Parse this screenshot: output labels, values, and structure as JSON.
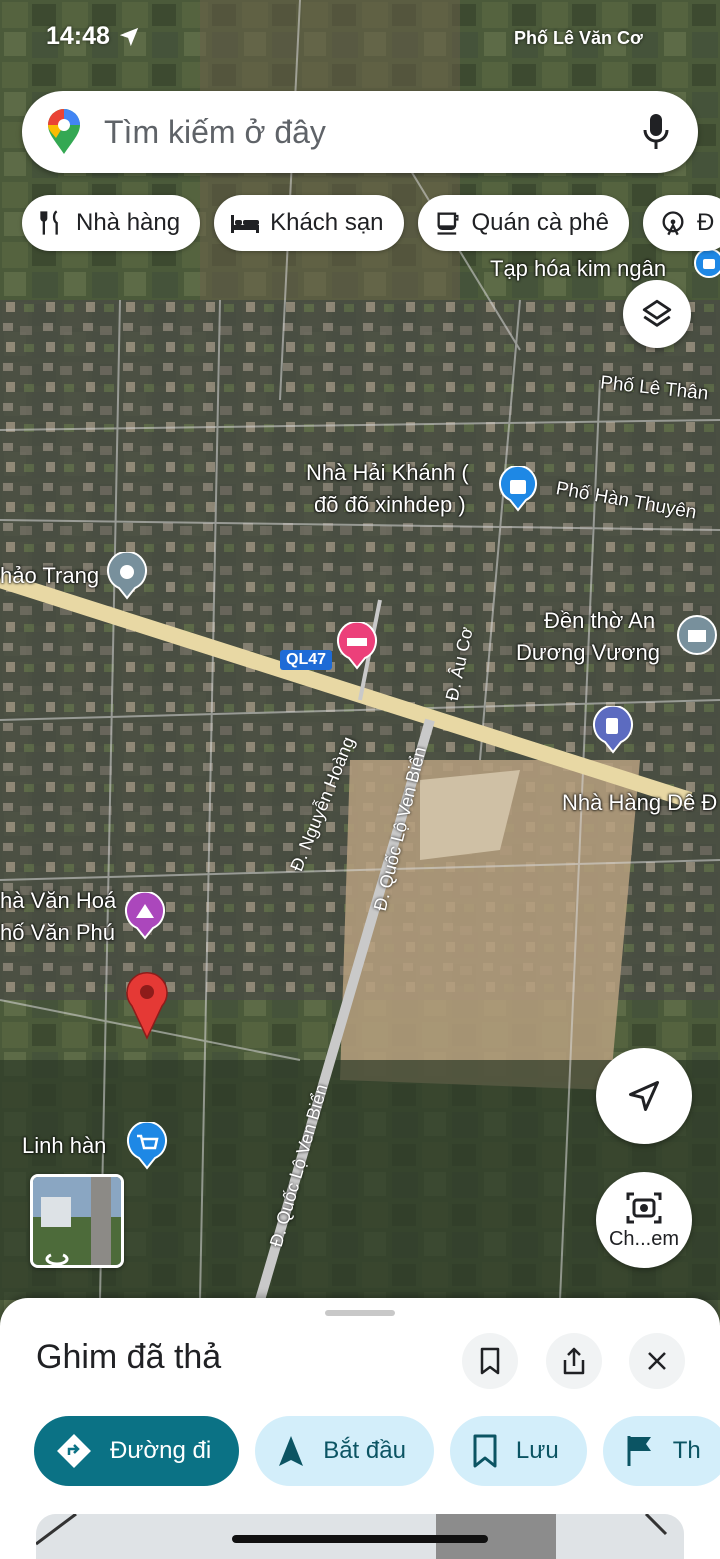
{
  "status": {
    "time": "14:48",
    "right_text": "Phố Lê Văn Cơ"
  },
  "search": {
    "placeholder": "Tìm kiếm ở đây"
  },
  "chips": [
    {
      "label": "Nhà hàng",
      "icon": "restaurant-icon"
    },
    {
      "label": "Khách sạn",
      "icon": "hotel-icon"
    },
    {
      "label": "Quán cà phê",
      "icon": "coffee-icon"
    },
    {
      "label": "Đ",
      "icon": "attractions-icon"
    }
  ],
  "map_labels": {
    "tap_hoa": "Tạp hóa kim ngân",
    "pho_le_than": "Phố Lê Thân",
    "nha_hai_khanh_1": "Nhà Hải Khánh (",
    "nha_hai_khanh_2": "đõ đõ xinhdep )",
    "pho_han_thuyen": "Phố Hàn Thuyên",
    "thao_trang": "hảo Trang",
    "den_tho_1": "Đền thờ An",
    "den_tho_2": "Dương Vương",
    "ql47": "QL47",
    "d_au_co": "Đ. Âu Cơ",
    "d_nguyen_hoang": "Đ. Nguyễn Hoàng",
    "d_ql_ven_bien_1": "Đ. Quốc Lộ Ven Biển",
    "d_ql_ven_bien_2": "Đ. Quốc Lộ Ven Biển",
    "nha_hang_de": "Nhà Hàng Dê Đ",
    "nha_van_hoa_1": "hà Văn Hoá",
    "nha_van_hoa_2": "hố Văn Phú",
    "linh_han": "Linh hàn"
  },
  "camera_label": "Ch...em",
  "sheet": {
    "title": "Ghim đã thả",
    "actions": [
      {
        "label": "Đường đi",
        "icon": "directions-icon"
      },
      {
        "label": "Bắt đầu",
        "icon": "navigation-icon"
      },
      {
        "label": "Lưu",
        "icon": "bookmark-icon"
      },
      {
        "label": "Th",
        "icon": "flag-icon"
      }
    ]
  },
  "colors": {
    "accent": "#0b7285",
    "pin_red": "#e53935",
    "chip_bg": "#d3eefa"
  }
}
